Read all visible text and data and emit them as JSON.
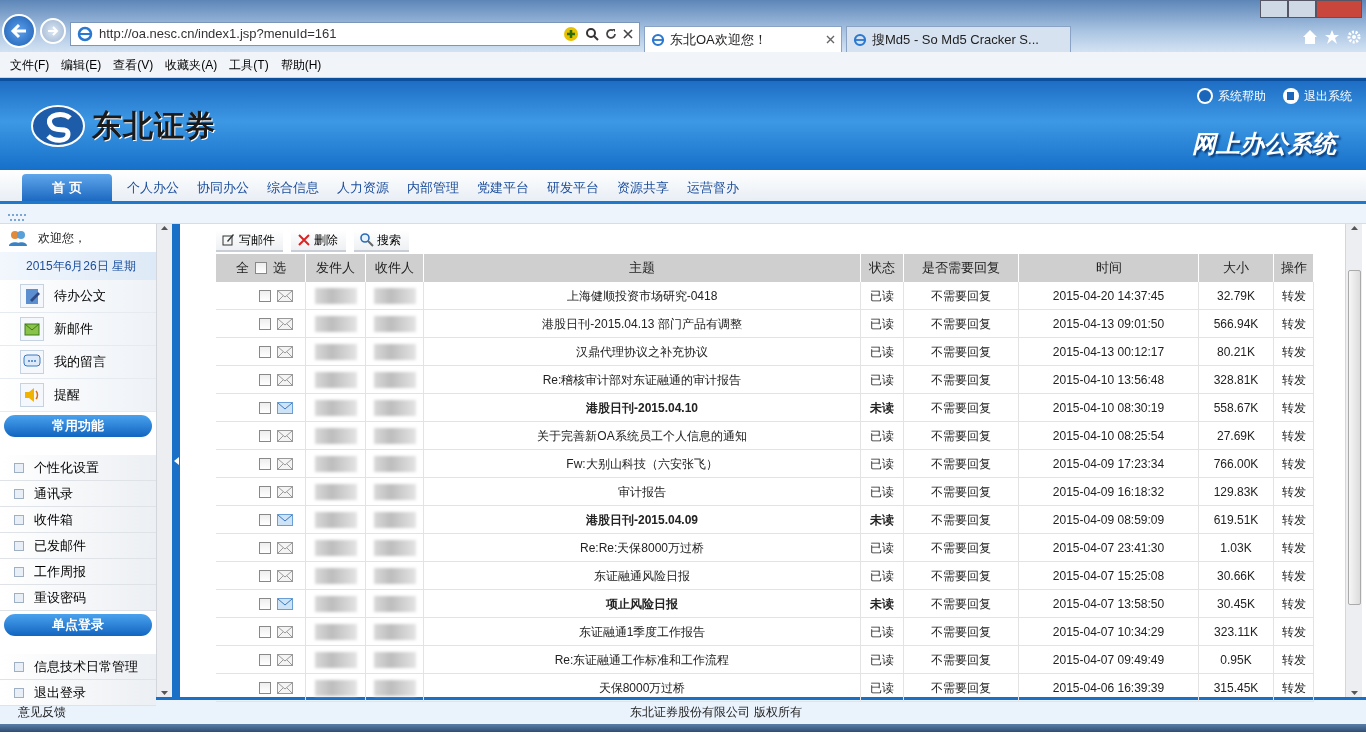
{
  "browser": {
    "address": "http://oa.nesc.cn/index1.jsp?menuId=161",
    "tabs": [
      {
        "title": "东北OA欢迎您！",
        "selected": true,
        "closable": true
      },
      {
        "title": "搜Md5 - So Md5 Cracker S...",
        "selected": false,
        "closable": false
      }
    ],
    "menu": [
      "文件(F)",
      "编辑(E)",
      "查看(V)",
      "收藏夹(A)",
      "工具(T)",
      "帮助(H)"
    ]
  },
  "header": {
    "logo_text": "东北证券",
    "system_title": "网上办公系统",
    "links": [
      "系统帮助",
      "退出系统"
    ]
  },
  "nav": [
    {
      "label": "首 页",
      "selected": true
    },
    {
      "label": "个人办公",
      "selected": false
    },
    {
      "label": "协同办公",
      "selected": false
    },
    {
      "label": "综合信息",
      "selected": false
    },
    {
      "label": "人力资源",
      "selected": false
    },
    {
      "label": "内部管理",
      "selected": false
    },
    {
      "label": "党建平台",
      "selected": false
    },
    {
      "label": "研发平台",
      "selected": false
    },
    {
      "label": "资源共享",
      "selected": false
    },
    {
      "label": "运营督办",
      "selected": false
    }
  ],
  "sidebar": {
    "welcome": "欢迎您，",
    "date": "2015年6月26日  星期",
    "quick_items": [
      {
        "label": "待办公文",
        "kind": "doc"
      },
      {
        "label": "新邮件",
        "kind": "mail"
      },
      {
        "label": "我的留言",
        "kind": "chat"
      },
      {
        "label": "提醒",
        "kind": "sound"
      }
    ],
    "sections": [
      {
        "title": "常用功能",
        "items": [
          "个性化设置",
          "通讯录",
          "收件箱",
          "已发邮件",
          "工作周报",
          "重设密码"
        ]
      },
      {
        "title": "单点登录",
        "items": [
          "信息技术日常管理",
          "退出登录"
        ]
      }
    ]
  },
  "toolbar": [
    {
      "label": "写邮件",
      "kind": "write"
    },
    {
      "label": "删除",
      "kind": "delete"
    },
    {
      "label": "搜索",
      "kind": "search"
    }
  ],
  "table": {
    "select_header": {
      "left": "全",
      "right": "选",
      "checked": false
    },
    "columns": [
      "发件人",
      "收件人",
      "主题",
      "状态",
      "是否需要回复",
      "时间",
      "大小",
      "操作"
    ],
    "rows": [
      {
        "checked": false,
        "unread": false,
        "subject": "上海健顺投资市场研究-0418",
        "status": "已读",
        "reply": "不需要回复",
        "time": "2015-04-20 14:37:45",
        "size": "32.79K",
        "action": "转发"
      },
      {
        "checked": false,
        "unread": false,
        "subject": "港股日刊-2015.04.13 部门产品有调整",
        "status": "已读",
        "reply": "不需要回复",
        "time": "2015-04-13 09:01:50",
        "size": "566.94K",
        "action": "转发"
      },
      {
        "checked": false,
        "unread": false,
        "subject": "汉鼎代理协议之补充协议",
        "status": "已读",
        "reply": "不需要回复",
        "time": "2015-04-13 00:12:17",
        "size": "80.21K",
        "action": "转发"
      },
      {
        "checked": false,
        "unread": false,
        "subject": "Re:稽核审计部对东证融通的审计报告",
        "status": "已读",
        "reply": "不需要回复",
        "time": "2015-04-10 13:56:48",
        "size": "328.81K",
        "action": "转发"
      },
      {
        "checked": false,
        "unread": true,
        "subject": "港股日刊-2015.04.10",
        "status": "未读",
        "reply": "不需要回复",
        "time": "2015-04-10 08:30:19",
        "size": "558.67K",
        "action": "转发"
      },
      {
        "checked": false,
        "unread": false,
        "subject": "关于完善新OA系统员工个人信息的通知",
        "status": "已读",
        "reply": "不需要回复",
        "time": "2015-04-10 08:25:54",
        "size": "27.69K",
        "action": "转发"
      },
      {
        "checked": false,
        "unread": false,
        "subject": "Fw:大别山科技（六安张飞）",
        "status": "已读",
        "reply": "不需要回复",
        "time": "2015-04-09 17:23:34",
        "size": "766.00K",
        "action": "转发"
      },
      {
        "checked": false,
        "unread": false,
        "subject": "审计报告",
        "status": "已读",
        "reply": "不需要回复",
        "time": "2015-04-09 16:18:32",
        "size": "129.83K",
        "action": "转发"
      },
      {
        "checked": false,
        "unread": true,
        "subject": "港股日刊-2015.04.09",
        "status": "未读",
        "reply": "不需要回复",
        "time": "2015-04-09 08:59:09",
        "size": "619.51K",
        "action": "转发"
      },
      {
        "checked": false,
        "unread": false,
        "subject": "Re:Re:天保8000万过桥",
        "status": "已读",
        "reply": "不需要回复",
        "time": "2015-04-07 23:41:30",
        "size": "1.03K",
        "action": "转发"
      },
      {
        "checked": false,
        "unread": false,
        "subject": "东证融通风险日报",
        "status": "已读",
        "reply": "不需要回复",
        "time": "2015-04-07 15:25:08",
        "size": "30.66K",
        "action": "转发"
      },
      {
        "checked": false,
        "unread": true,
        "subject": "项止风险日报",
        "status": "未读",
        "reply": "不需要回复",
        "time": "2015-04-07 13:58:50",
        "size": "30.45K",
        "action": "转发"
      },
      {
        "checked": false,
        "unread": false,
        "subject": "东证融通1季度工作报告",
        "status": "已读",
        "reply": "不需要回复",
        "time": "2015-04-07 10:34:29",
        "size": "323.11K",
        "action": "转发"
      },
      {
        "checked": false,
        "unread": false,
        "subject": "Re:东证融通工作标准和工作流程",
        "status": "已读",
        "reply": "不需要回复",
        "time": "2015-04-07 09:49:49",
        "size": "0.95K",
        "action": "转发"
      },
      {
        "checked": false,
        "unread": false,
        "subject": "天保8000万过桥",
        "status": "已读",
        "reply": "不需要回复",
        "time": "2015-04-06 16:39:39",
        "size": "315.45K",
        "action": "转发"
      }
    ]
  },
  "footer": {
    "feedback": "意见反馈",
    "copyright": "东北证券股份有限公司  版权所有"
  }
}
